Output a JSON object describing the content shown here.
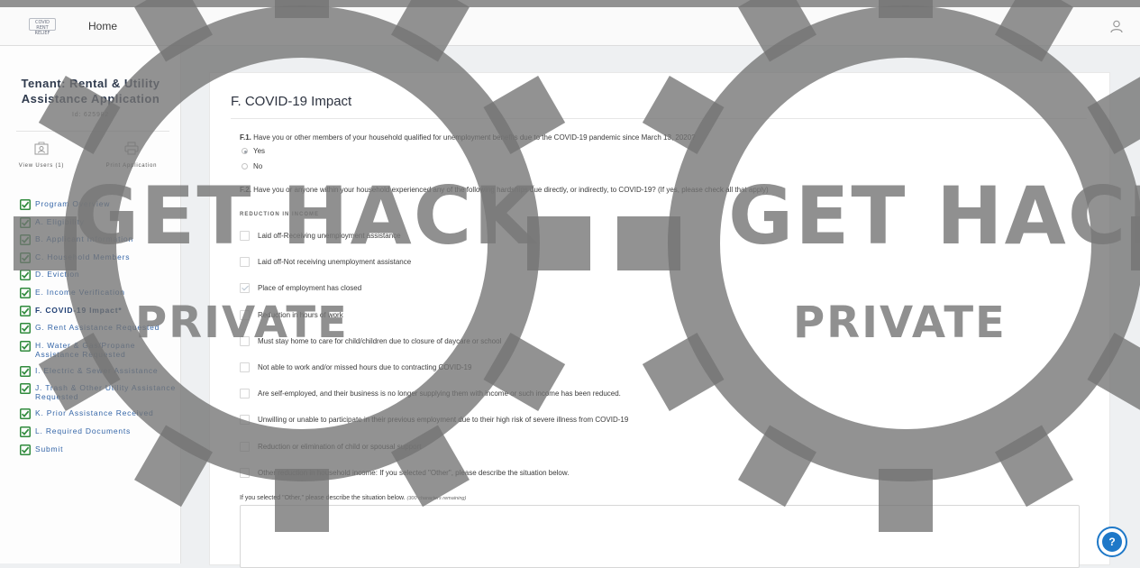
{
  "topbar": {
    "logo_text": "COVID\nRENT\nRELIEF",
    "home_label": "Home"
  },
  "sidebar": {
    "title": "Tenant: Rental & Utility Assistance Application",
    "id_text": "Id: 625982",
    "view_users_label": "View Users (1)",
    "print_label": "Print Application",
    "nav": [
      {
        "label": "Program Overview"
      },
      {
        "label": "A. Eligibility"
      },
      {
        "label": "B. Applicant Information"
      },
      {
        "label": "C. Household Members"
      },
      {
        "label": "D. Eviction"
      },
      {
        "label": "E. Income Verification"
      },
      {
        "label": "F. COVID-19 Impact*",
        "active": true
      },
      {
        "label": "G. Rent Assistance Requested"
      },
      {
        "label": "H. Water & Gas/Propane Assistance Requested"
      },
      {
        "label": "I. Electric & Sewer Assistance"
      },
      {
        "label": "J. Trash & Other Utility Assistance Requested"
      },
      {
        "label": "K. Prior Assistance Received"
      },
      {
        "label": "L. Required Documents"
      },
      {
        "label": "Submit"
      }
    ]
  },
  "main": {
    "section_title": "F. COVID-19 Impact",
    "f1": {
      "num": "F.1.",
      "text": "Have you or other members of your household qualified for unemployment benefits due to the COVID-19 pandemic since March 13, 2020?",
      "options": [
        {
          "label": "Yes",
          "selected": true
        },
        {
          "label": "No",
          "selected": false
        }
      ]
    },
    "f2": {
      "num": "F.2.",
      "text": "Have you or anyone within your household experienced any of the following hardships due directly, or indirectly, to COVID-19? (If yes, please check all that apply)"
    },
    "subheading": "REDUCTION IN INCOME",
    "hardships": [
      {
        "label": "Laid off-Receiving unemployment assistance",
        "checked": false
      },
      {
        "label": "Laid off-Not receiving unemployment assistance",
        "checked": false
      },
      {
        "label": "Place of employment has closed",
        "checked": true
      },
      {
        "label": "Reduction in hours of work",
        "checked": false
      },
      {
        "label": "Must stay home to care for child/children due to closure of daycare or school",
        "checked": false
      },
      {
        "label": "Not able to work and/or missed hours due to contracting COVID-19",
        "checked": false
      },
      {
        "label": "Are self-employed, and their business is no longer supplying them with income or such income has been reduced.",
        "checked": false
      },
      {
        "label": "Unwilling or unable to participate in their previous employment due to their high risk of severe illness from COVID-19",
        "checked": false
      },
      {
        "label": "Reduction or elimination of child or spousal support",
        "checked": false
      },
      {
        "label": "Other reduction in household income: If you selected \"Other\", please describe the situation below.",
        "checked": false
      }
    ],
    "other_label": "If you selected \"Other,\" please describe the situation below.",
    "other_hint": "(300 characters remaining)"
  },
  "help_label": "?",
  "watermark": {
    "big": "GET HACK",
    "small": "PRIVATE"
  },
  "colors": {
    "nav_link": "#3566a8",
    "check_green": "#2f8a3c",
    "help_blue": "#1e78c8",
    "watermark_gray": "#787878"
  }
}
